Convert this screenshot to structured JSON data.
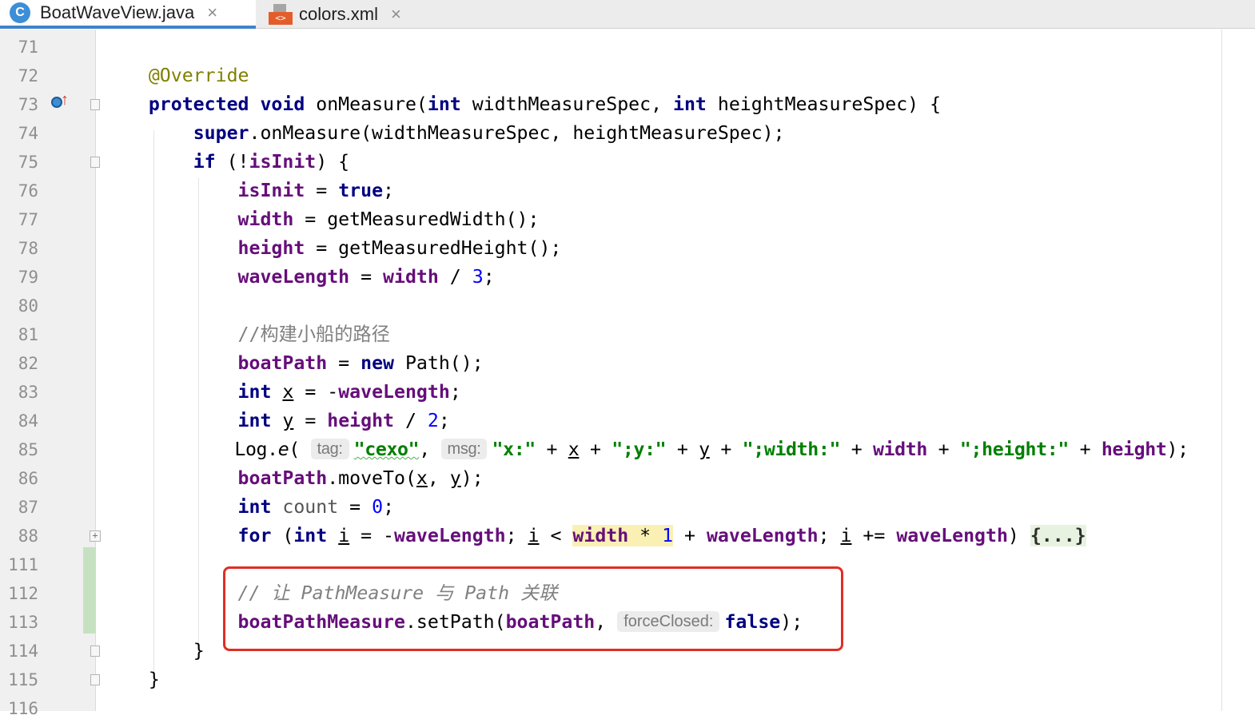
{
  "tabs": [
    {
      "label": "BoatWaveView.java",
      "icon": "java-class-icon",
      "icon_text": "C",
      "close": "×",
      "active": true
    },
    {
      "label": "colors.xml",
      "icon": "xml-file-icon",
      "icon_text": "<>",
      "close": "×",
      "active": false
    }
  ],
  "line_numbers": [
    "71",
    "72",
    "73",
    "74",
    "75",
    "76",
    "77",
    "78",
    "79",
    "80",
    "81",
    "82",
    "83",
    "84",
    "85",
    "86",
    "87",
    "88",
    "111",
    "112",
    "113",
    "114",
    "115",
    "116"
  ],
  "code": {
    "l72": {
      "annotation": "@Override"
    },
    "l73": {
      "kw1": "protected",
      "kw2": "void",
      "name": "onMeasure(",
      "kw3": "int",
      "p1": " widthMeasureSpec, ",
      "kw4": "int",
      "p2": " heightMeasureSpec) {"
    },
    "l74": {
      "kw": "super",
      "rest": ".onMeasure(widthMeasureSpec, heightMeasureSpec);"
    },
    "l75": {
      "kw": "if",
      "a": " (!",
      "field": "isInit",
      "b": ") {"
    },
    "l76": {
      "field": "isInit",
      "a": " = ",
      "kw": "true",
      "b": ";"
    },
    "l77": {
      "field": "width",
      "rest": " = getMeasuredWidth();"
    },
    "l78": {
      "field": "height",
      "rest": " = getMeasuredHeight();"
    },
    "l79": {
      "field1": "waveLength",
      "a": " = ",
      "field2": "width",
      "b": " / ",
      "num": "3",
      "c": ";"
    },
    "l81": {
      "comment": "//构建小船的路径"
    },
    "l82": {
      "field": "boatPath",
      "a": " = ",
      "kw": "new",
      "b": " Path();"
    },
    "l83": {
      "kw": "int",
      "a": " ",
      "var": "x",
      "b": " = -",
      "field": "waveLength",
      "c": ";"
    },
    "l84": {
      "kw": "int",
      "a": " ",
      "var": "y",
      "b": " = ",
      "field": "height",
      "c": " / ",
      "num": "2",
      "d": ";"
    },
    "l85": {
      "a": "Log.",
      "method": "e",
      "b": "( ",
      "hint1": "tag:",
      "s1": "\"cexo\"",
      "c": ", ",
      "hint2": "msg:",
      "s2": "\"x:\"",
      "d": " + ",
      "v1": "x",
      "e": " + ",
      "s3": "\";y:\"",
      "f": " + ",
      "v2": "y",
      "g": " + ",
      "s4": "\";width:\"",
      "h": " + ",
      "f1": "width",
      "i": " + ",
      "s5": "\";height:\"",
      "j": " + ",
      "f2": "height",
      "k": ");"
    },
    "l86": {
      "field": "boatPath",
      "a": ".moveTo(",
      "v1": "x",
      "b": ", ",
      "v2": "y",
      "c": ");"
    },
    "l87": {
      "kw": "int",
      "a": " ",
      "lvar": "count",
      "b": " = ",
      "num": "0",
      "c": ";"
    },
    "l88": {
      "kw1": "for",
      "a": " (",
      "kw2": "int",
      "b": " ",
      "v1": "i",
      "c": " = -",
      "f1": "waveLength",
      "d": "; ",
      "v2": "i",
      "e": " < ",
      "hl_field": "width",
      "hl_op": " * ",
      "hl_num": "1",
      "f": " + ",
      "f2": "waveLength",
      "g": "; ",
      "v3": "i",
      "h": " += ",
      "f3": "waveLength",
      "i": ") ",
      "fold": "{...}"
    },
    "l112": {
      "comment": "// 让 PathMeasure 与 Path 关联"
    },
    "l113": {
      "field1": "boatPathMeasure",
      "a": ".setPath(",
      "field2": "boatPath",
      "b": ", ",
      "hint": "forceClosed:",
      "kw": "false",
      "c": ");"
    },
    "l114": {
      "brace": "}"
    },
    "l115": {
      "brace": "}"
    }
  },
  "gutter_icons": {
    "override": "override-method-icon",
    "arrow": "↑"
  },
  "colors": {
    "keyword": "#000080",
    "field": "#660e7a",
    "string": "#008000",
    "number": "#0000ff",
    "highlight_box": "#e02e24"
  }
}
